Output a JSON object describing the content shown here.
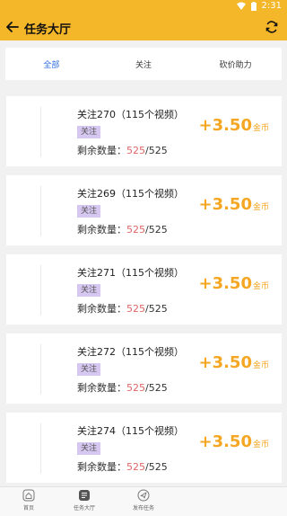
{
  "status_bar": {
    "time": "2:31"
  },
  "app_bar": {
    "title": "任务大厅"
  },
  "tabs": [
    {
      "label": "全部"
    },
    {
      "label": "关注"
    },
    {
      "label": "砍价助力"
    }
  ],
  "tasks": [
    {
      "name": "关注270（115个视频）",
      "tag": "关注",
      "remain_label": "剩余数量：",
      "remain_current": "525",
      "remain_sep": "/",
      "remain_total": "525",
      "reward": "+3.50",
      "reward_unit": "金币"
    },
    {
      "name": "关注269（115个视频）",
      "tag": "关注",
      "remain_label": "剩余数量：",
      "remain_current": "525",
      "remain_sep": "/",
      "remain_total": "525",
      "reward": "+3.50",
      "reward_unit": "金币"
    },
    {
      "name": "关注271（115个视频）",
      "tag": "关注",
      "remain_label": "剩余数量：",
      "remain_current": "525",
      "remain_sep": "/",
      "remain_total": "525",
      "reward": "+3.50",
      "reward_unit": "金币"
    },
    {
      "name": "关注272（115个视频）",
      "tag": "关注",
      "remain_label": "剩余数量：",
      "remain_current": "525",
      "remain_sep": "/",
      "remain_total": "525",
      "reward": "+3.50",
      "reward_unit": "金币"
    },
    {
      "name": "关注274（115个视频）",
      "tag": "关注",
      "remain_label": "剩余数量：",
      "remain_current": "525",
      "remain_sep": "/",
      "remain_total": "525",
      "reward": "+3.50",
      "reward_unit": "金币"
    }
  ],
  "bottom_nav": [
    {
      "label": "首页",
      "icon": "home-icon"
    },
    {
      "label": "任务大厅",
      "icon": "task-hall-icon"
    },
    {
      "label": "发布任务",
      "icon": "send-icon"
    }
  ],
  "colors": {
    "accent": "#f5b72a",
    "reward": "#f5a623",
    "tag_bg": "#d6c7f1",
    "active_tab": "#2f6ddf",
    "remain_current": "#e06666"
  }
}
